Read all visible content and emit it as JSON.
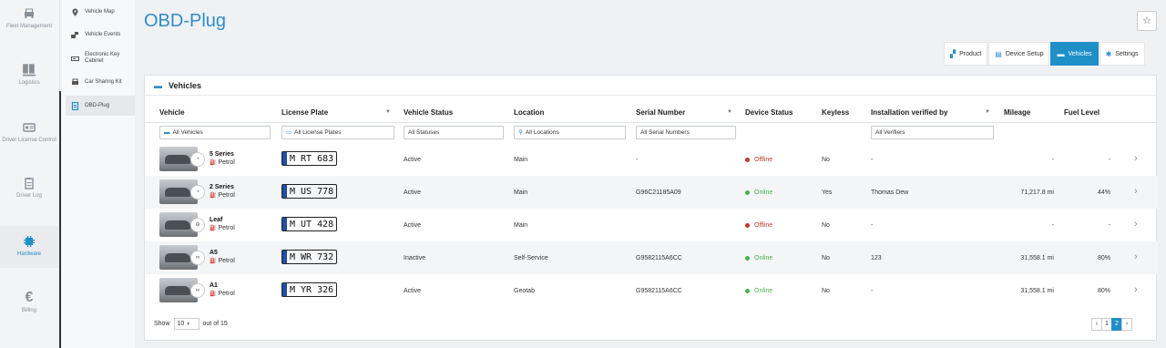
{
  "rail": {
    "items": [
      {
        "label": "Fleet Management",
        "icon": "car-front-icon"
      },
      {
        "label": "Logistics",
        "icon": "pallet-icon"
      },
      {
        "label": "Driver License Control",
        "icon": "id-card-icon"
      },
      {
        "label": "Driver Log",
        "icon": "clipboard-icon"
      },
      {
        "label": "Hardware",
        "icon": "chip-icon"
      },
      {
        "label": "Billing",
        "icon": "euro-icon"
      }
    ],
    "active_index": 4
  },
  "subnav": {
    "items": [
      {
        "label": "Vehicle Map"
      },
      {
        "label": "Vehicle Events"
      },
      {
        "label": "Electronic Key Cabinet"
      },
      {
        "label": "Car Sharing Kit"
      },
      {
        "label": "OBD-Plug"
      }
    ],
    "active_index": 4
  },
  "page": {
    "title": "OBD-Plug",
    "star": "☆"
  },
  "tabs": [
    {
      "label": "Product",
      "icon": "plug-icon"
    },
    {
      "label": "Device Setup",
      "icon": "device-icon"
    },
    {
      "label": "Vehicles",
      "icon": "car-icon"
    },
    {
      "label": "Settings",
      "icon": "gear-icon"
    }
  ],
  "active_tab": 2,
  "panel": {
    "title": "Vehicles"
  },
  "table": {
    "columns": [
      "Vehicle",
      "License Plate",
      "Vehicle Status",
      "Location",
      "Serial Number",
      "Device Status",
      "Keyless",
      "Installation verified by",
      "Mileage",
      "Fuel Level"
    ],
    "filters": {
      "vehicle": "All Vehicles",
      "plate": "All License Plates",
      "status": "All Statuses",
      "location": "All Locations",
      "serial": "All Serial Numbers",
      "verifier": "All Verifiers"
    },
    "rows": [
      {
        "model": "5 Series",
        "brand": "BMW",
        "fuel": "Petrol",
        "plate": "M RT 683",
        "vehicle_status": "Active",
        "location": "Main",
        "serial": "-",
        "device_status": "Offline",
        "keyless": "No",
        "verified_by": "-",
        "mileage": "-",
        "fuel_level": "-"
      },
      {
        "model": "2 Series",
        "brand": "BMW",
        "fuel": "Petrol",
        "plate": "M US 778",
        "vehicle_status": "Active",
        "location": "Main",
        "serial": "G96C21185A09",
        "device_status": "Online",
        "keyless": "Yes",
        "verified_by": "Thomas Dew",
        "mileage": "71,217.8 mi",
        "fuel_level": "44%"
      },
      {
        "model": "Leaf",
        "brand": "Nissan",
        "fuel": "Petrol",
        "plate": "M UT 428",
        "vehicle_status": "Active",
        "location": "Main",
        "serial": "",
        "device_status": "Offline",
        "keyless": "No",
        "verified_by": "-",
        "mileage": "-",
        "fuel_level": "-"
      },
      {
        "model": "A5",
        "brand": "Audi",
        "fuel": "Petrol",
        "plate": "M WR 732",
        "vehicle_status": "Inactive",
        "location": "Self-Service",
        "serial": "G9582115A6CC",
        "device_status": "Online",
        "keyless": "No",
        "verified_by": "123",
        "mileage": "31,558.1 mi",
        "fuel_level": "80%"
      },
      {
        "model": "A1",
        "brand": "Audi",
        "fuel": "Petrol",
        "plate": "M YR 326",
        "vehicle_status": "Active",
        "location": "Geotab",
        "serial": "G9582115A6CC",
        "device_status": "Online",
        "keyless": "No",
        "verified_by": "-",
        "mileage": "31,558.1 mi",
        "fuel_level": "80%"
      }
    ]
  },
  "status_colors": {
    "Online": "#4caf50",
    "Offline": "#c0392b"
  },
  "footer": {
    "show_label": "Show",
    "page_size": "10",
    "of_label": "out of 15",
    "pages": [
      "1",
      "2"
    ],
    "current_page": "2"
  }
}
